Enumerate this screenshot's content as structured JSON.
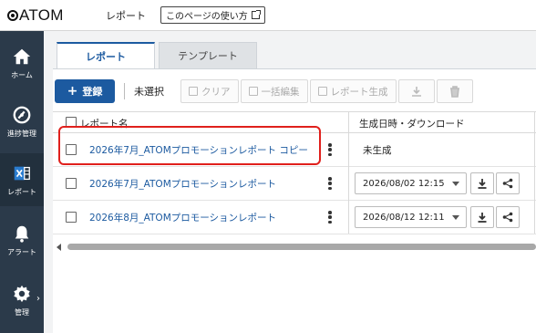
{
  "header": {
    "logo_text": "ATOM",
    "breadcrumb": "レポート",
    "guide_button": "このページの使い方"
  },
  "sidebar": {
    "items": [
      {
        "label": "ホーム",
        "icon": "home-icon"
      },
      {
        "label": "進捗管理",
        "icon": "gauge-icon"
      },
      {
        "label": "レポート",
        "icon": "spreadsheet-icon",
        "active": true
      },
      {
        "label": "アラート",
        "icon": "bell-icon"
      },
      {
        "label": "管理",
        "icon": "gear-icon"
      }
    ],
    "expand_chevron": "›"
  },
  "tabs": [
    {
      "label": "レポート",
      "active": true
    },
    {
      "label": "テンプレート",
      "active": false
    }
  ],
  "toolbar": {
    "register_label": "登録",
    "selection_status": "未選択",
    "clear_label": "クリア",
    "bulk_edit_label": "一括編集",
    "generate_label": "レポート生成"
  },
  "table": {
    "columns": [
      "レポート名",
      "生成日時・ダウンロード"
    ],
    "rows": [
      {
        "name": "2026年7月_ATOMプロモーションレポート コピー",
        "status": "未生成",
        "date": ""
      },
      {
        "name": "2026年7月_ATOMプロモーションレポート",
        "status": "",
        "date": "2026/08/02 12:15"
      },
      {
        "name": "2026年8月_ATOMプロモーションレポート",
        "status": "",
        "date": "2026/08/12 12:11"
      }
    ]
  },
  "colors": {
    "accent": "#1c5aa0",
    "sidebar_bg": "#2b3a4a",
    "highlight": "#e0201c"
  }
}
